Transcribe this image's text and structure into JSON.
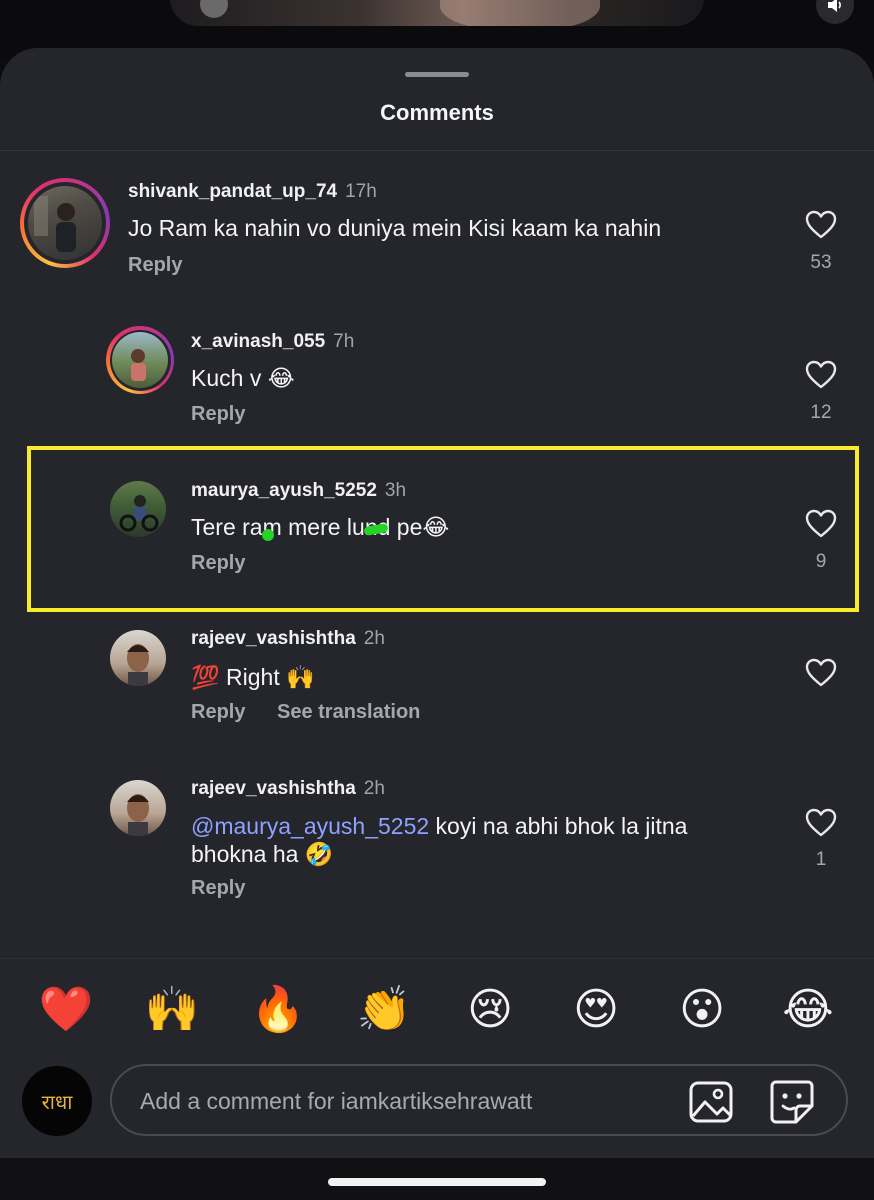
{
  "sheet": {
    "title": "Comments"
  },
  "comments": [
    {
      "username": "shivank_pandat_up_74",
      "time": "17h",
      "text": "Jo Ram ka nahin vo duniya mein Kisi kaam ka nahin",
      "reply": "Reply",
      "likes": "53"
    },
    {
      "username": "x_avinash_055",
      "time": "7h",
      "text": "Kuch v 😂",
      "reply": "Reply",
      "likes": "12"
    },
    {
      "username": "maurya_ayush_5252",
      "time": "3h",
      "text": "Tere ram mere lund pe😂",
      "reply": "Reply",
      "likes": "9"
    },
    {
      "username": "rajeev_vashishtha",
      "time": "2h",
      "text": "💯 Right 🙌",
      "reply": "Reply",
      "see_translation": "See translation",
      "likes": ""
    },
    {
      "username": "rajeev_vashishtha",
      "time": "2h",
      "mention": "@maurya_ayush_5252",
      "text_after": " koyi na abhi bhok la jitna bhokna ha 🤣",
      "reply": "Reply",
      "likes": "1"
    }
  ],
  "emoji_bar": [
    "❤️",
    "🙌",
    "🔥",
    "👏",
    "😢",
    "😍",
    "😮",
    "😂"
  ],
  "composer": {
    "avatar_text": "राधा",
    "placeholder": "Add a comment for iamkartiksehrawatt"
  },
  "colors": {
    "highlight": "#f6ec2a",
    "sheet": "#25262b",
    "mention": "#8da2ff"
  }
}
